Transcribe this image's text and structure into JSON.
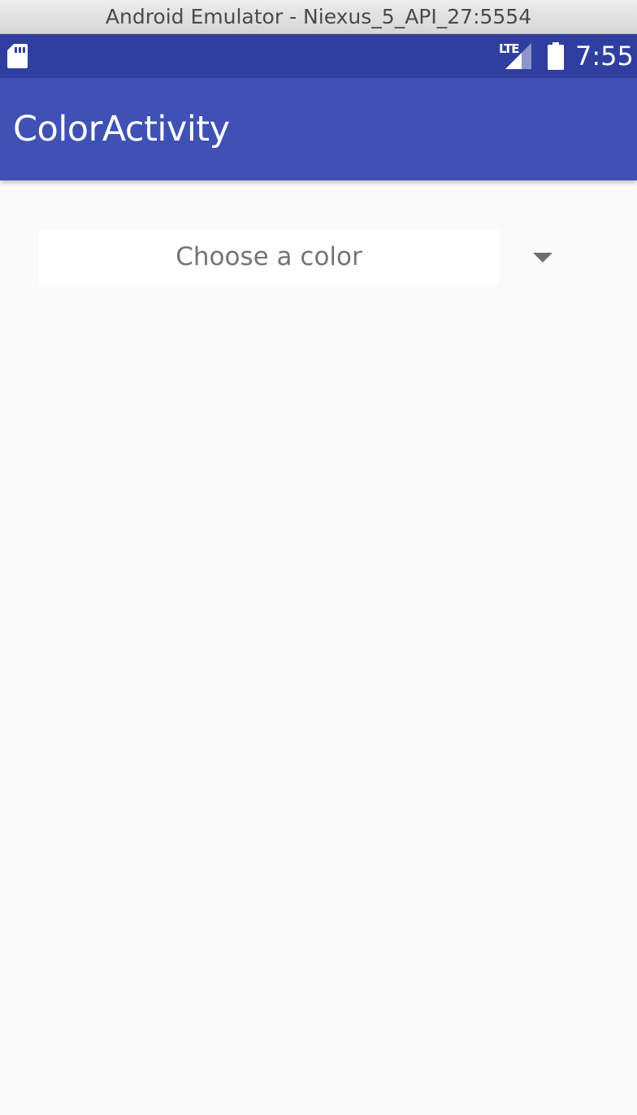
{
  "window": {
    "title": "Android Emulator - Niexus_5_API_27:5554"
  },
  "status_bar": {
    "color": "#303f9f",
    "left_icon": "sd-card-icon",
    "network_label": "LTE",
    "network_icon": "signal-icon",
    "battery_icon": "battery-icon",
    "time": "7:55"
  },
  "app_bar": {
    "color": "#3f51b5",
    "title": "ColorActivity"
  },
  "spinner": {
    "prompt": "Choose a color",
    "arrow_icon": "dropdown-arrow-icon"
  }
}
